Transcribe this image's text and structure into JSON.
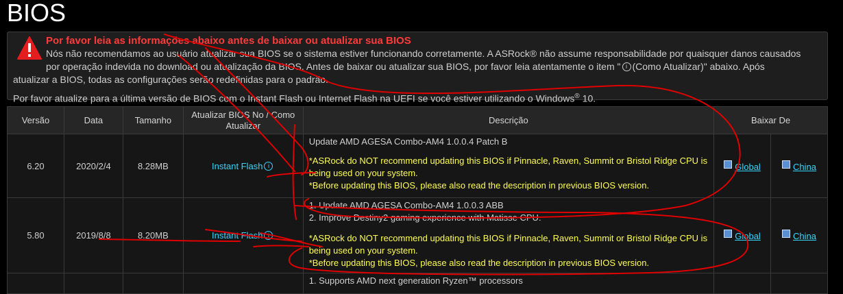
{
  "page": {
    "title": "BIOS"
  },
  "warning": {
    "title": "Por favor leia as informações abaixo antes de baixar ou atualizar sua BIOS",
    "text_1": "Nós não recomendamos ao usuário atualizar sua BIOS se o sistema estiver funcionando corretamente. A ASRock® não assume responsabilidade por quaisquer danos causados",
    "text_2": "por operação indevida no download ou atualização da BIOS. Antes de baixar ou atualizar sua BIOS, por favor leia atentamente o item \"",
    "text_2_end": "(Como Atualizar)\" abaixo. Após",
    "text_3": "atualizar a BIOS, todas as configurações serão redefinidas para o padrão.",
    "text_4": "Por favor atualize para a última versão de BIOS com o Instant Flash ou Internet Flash na UEFI se você estiver utilizando o Windows",
    "text_4_sup": "®",
    "text_4_end": " 10."
  },
  "table": {
    "headers": {
      "version": "Versão",
      "date": "Data",
      "size": "Tamanho",
      "update": "Atualizar BIOS No / Como Atualizar",
      "description": "Descrição",
      "download": "Baixar De"
    },
    "rows": [
      {
        "version": "6.20",
        "date": "2020/2/4",
        "size": "8.28MB",
        "update_link": "Instant Flash",
        "desc_lines": [
          "Update AMD AGESA Combo-AM4 1.0.0.4 Patch B"
        ],
        "warning_1": "*ASRock do NOT recommend updating this BIOS if Pinnacle, Raven, Summit or Bristol Ridge CPU is being used on your system.",
        "warning_2": "*Before updating this BIOS, please also read the description in previous BIOS version.",
        "download_global": "Global",
        "download_china": "China"
      },
      {
        "version": "5.80",
        "date": "2019/8/8",
        "size": "8.20MB",
        "update_link": "Instant Flash",
        "desc_lines": [
          "1. Update AMD AGESA Combo-AM4 1.0.0.3 ABB",
          "2. Improve Destiny2 gaming experience with Matisse CPU."
        ],
        "warning_1": "*ASRock do NOT recommend updating this BIOS if Pinnacle, Raven, Summit or Bristol Ridge CPU is being used on your system.",
        "warning_2": "*Before updating this BIOS, please also read the description in previous BIOS version.",
        "download_global": "Global",
        "download_china": "China"
      },
      {
        "desc_lines": [
          "1. Supports AMD next generation Ryzen™ processors"
        ]
      }
    ]
  },
  "icons": {
    "warning": "warning-triangle-icon",
    "info": "info-icon",
    "globe": "globe-icon"
  },
  "colors": {
    "accent_link": "#38d6ff",
    "warning_title": "#ff3b3b",
    "warning_text": "#ffff55",
    "annotation": "#e00000"
  }
}
